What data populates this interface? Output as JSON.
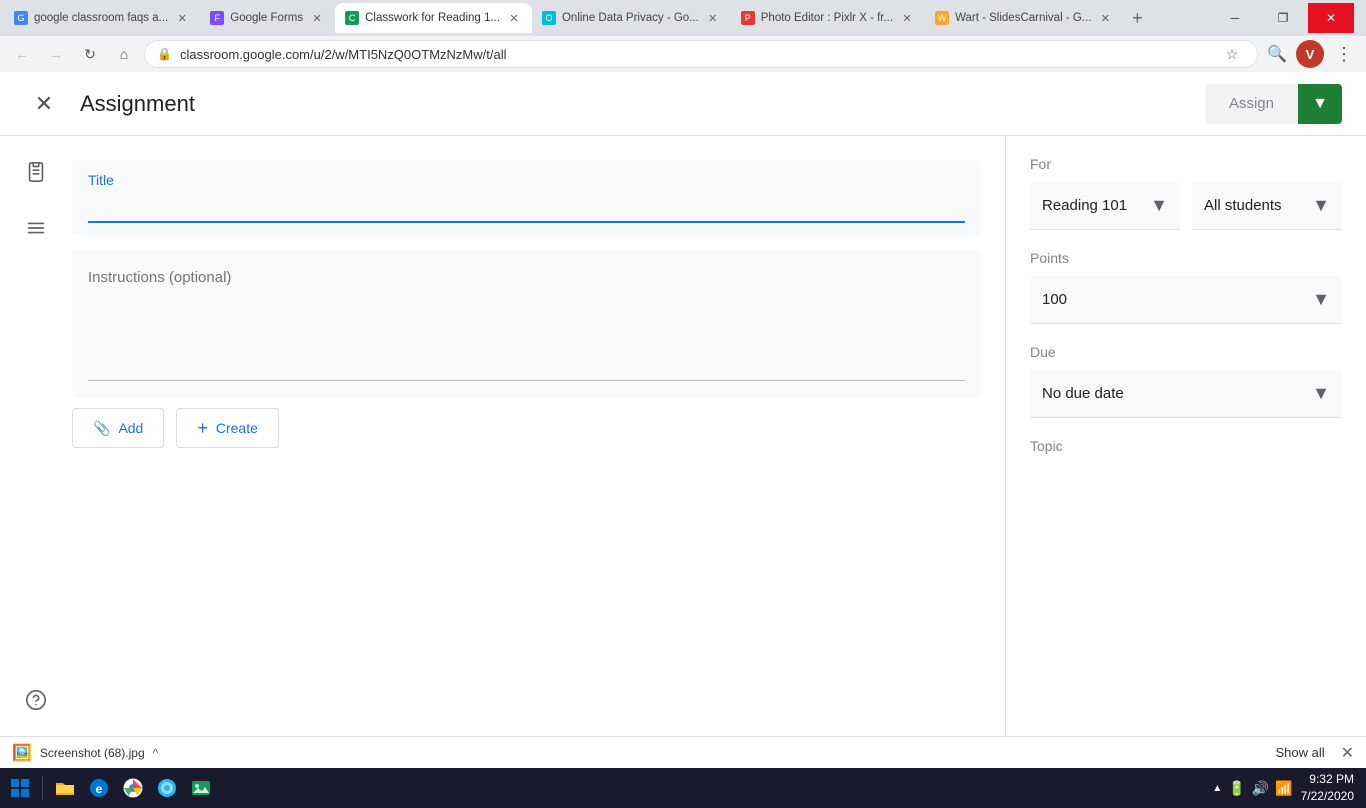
{
  "browser": {
    "tabs": [
      {
        "id": "tab1",
        "label": "google classroom faqs a...",
        "favicon_color": "#4285f4",
        "favicon_letter": "G",
        "active": false
      },
      {
        "id": "tab2",
        "label": "Google Forms",
        "favicon_color": "#7c4dff",
        "favicon_letter": "F",
        "active": false
      },
      {
        "id": "tab3",
        "label": "Classwork for Reading 1...",
        "favicon_color": "#0f9d58",
        "favicon_letter": "C",
        "active": true
      },
      {
        "id": "tab4",
        "label": "Online Data Privacy - Go...",
        "favicon_color": "#00bcd4",
        "favicon_letter": "O",
        "active": false
      },
      {
        "id": "tab5",
        "label": "Photo Editor : Pixlr X - fr...",
        "favicon_color": "#e53935",
        "favicon_letter": "P",
        "active": false
      },
      {
        "id": "tab6",
        "label": "Wart - SlidesCarnival - G...",
        "favicon_color": "#f9a825",
        "favicon_letter": "W",
        "active": false
      }
    ],
    "address": "classroom.google.com/u/2/w/MTI5NzQ0OTMzNzMw/t/all",
    "window_controls": {
      "minimize": "─",
      "maximize": "❐",
      "close": "✕"
    }
  },
  "header": {
    "title": "Assignment",
    "close_icon": "✕",
    "assign_label": "Assign",
    "dropdown_icon": "▼"
  },
  "sidebar": {
    "clipboard_icon": "📋",
    "lines_icon": "≡",
    "help_icon": "?"
  },
  "form": {
    "title_label": "Title",
    "title_placeholder": "",
    "instructions_placeholder": "Instructions (optional)",
    "add_button": "Add",
    "create_button": "Create",
    "add_icon": "📎",
    "create_icon": "+"
  },
  "right_panel": {
    "for_label": "For",
    "class_value": "Reading 101",
    "class_chevron": "▼",
    "students_value": "All students",
    "students_chevron": "▼",
    "points_label": "Points",
    "points_value": "100",
    "points_chevron": "▼",
    "due_label": "Due",
    "due_value": "No due date",
    "due_chevron": "▼",
    "topic_label": "Topic"
  },
  "download_bar": {
    "file_name": "Screenshot (68).jpg",
    "caret": "^",
    "show_all": "Show all",
    "close": "✕"
  },
  "taskbar": {
    "icons": [
      "🪟",
      "📁",
      "🌐",
      "🔵",
      "🌍",
      "🖼️"
    ],
    "clock_time": "9:32 PM",
    "clock_date": "7/22/2020"
  }
}
